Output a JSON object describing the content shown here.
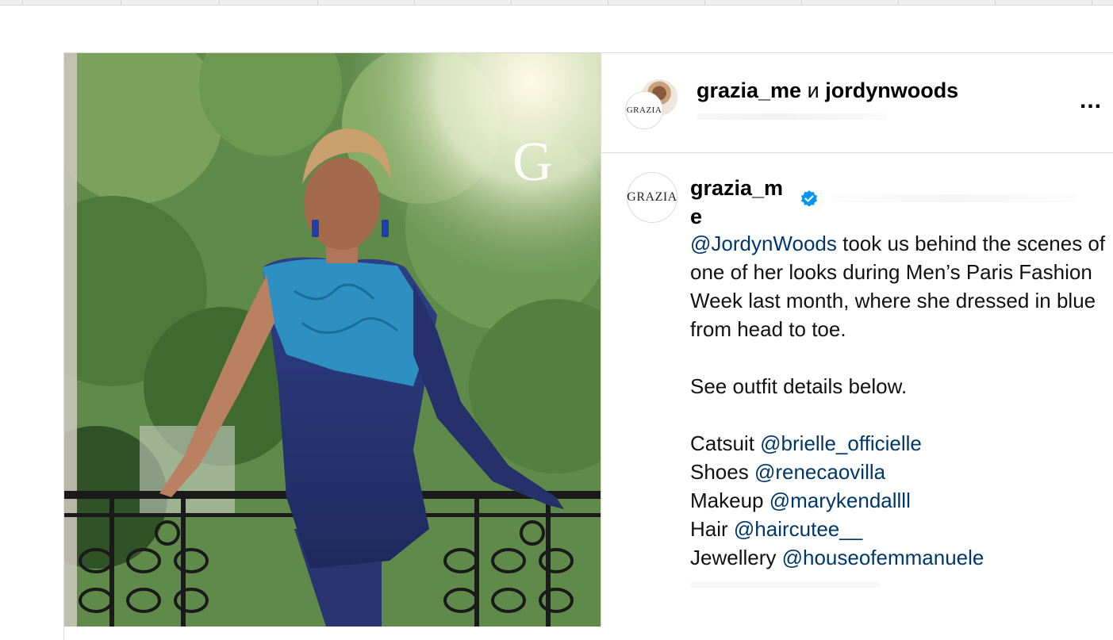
{
  "colors": {
    "mention": "#00376b",
    "verified": "#0095f6",
    "divider": "#dbdbdb"
  },
  "media": {
    "watermark_letter": "G",
    "description_icon": "photo"
  },
  "header": {
    "account_primary": "grazia_me",
    "connector": "и",
    "account_secondary": "jordynwoods",
    "more_icon": "more-horizontal-icon",
    "more_label": "..."
  },
  "brand_logo_text": "GRAZIA",
  "caption": {
    "username": "grazia_me",
    "verified_icon": "verified-badge-icon",
    "line1_mention": "@JordynWoods",
    "line1_text": " took us behind the scenes of one of her looks during Men’s Paris Fashion Week last month, where she dressed in blue from head to toe.",
    "details_intro": "See outfit details below.",
    "credits": [
      {
        "label": "Catsuit ",
        "handle": "@brielle_officielle"
      },
      {
        "label": "Shoes ",
        "handle": "@renecaovilla"
      },
      {
        "label": "Makeup ",
        "handle": "@marykendallll"
      },
      {
        "label": "Hair ",
        "handle": "@haircutee__"
      },
      {
        "label": "Jewellery ",
        "handle": "@houseofemmanuele"
      }
    ]
  }
}
